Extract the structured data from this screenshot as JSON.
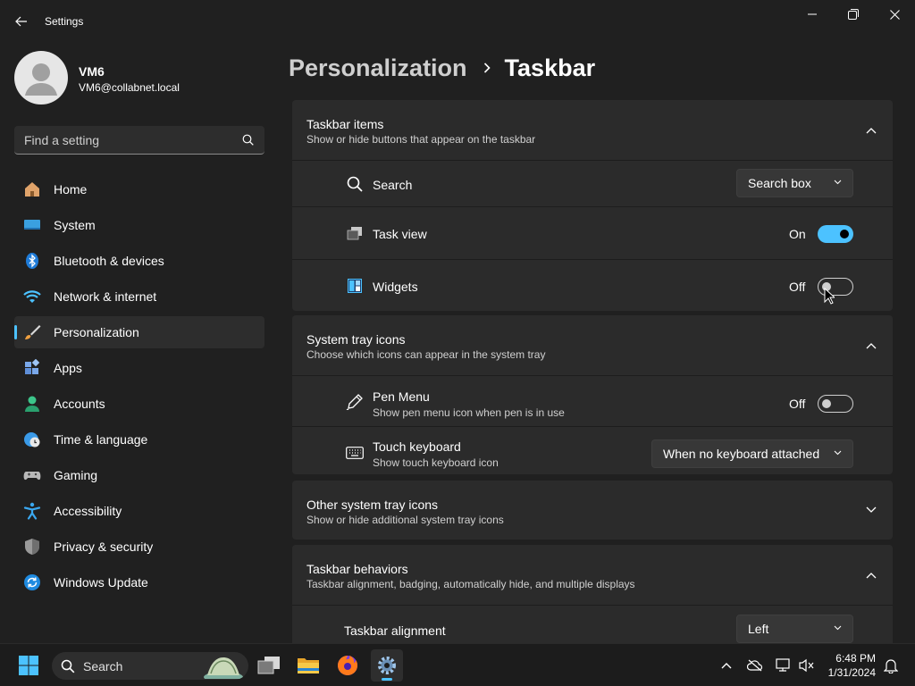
{
  "window": {
    "title": "Settings"
  },
  "user": {
    "name": "VM6",
    "email": "VM6@collabnet.local"
  },
  "search": {
    "placeholder": "Find a setting"
  },
  "nav": {
    "items": [
      {
        "label": "Home",
        "icon": "home-icon"
      },
      {
        "label": "System",
        "icon": "system-icon"
      },
      {
        "label": "Bluetooth & devices",
        "icon": "bluetooth-icon"
      },
      {
        "label": "Network & internet",
        "icon": "wifi-icon"
      },
      {
        "label": "Personalization",
        "icon": "brush-icon",
        "active": true
      },
      {
        "label": "Apps",
        "icon": "apps-icon"
      },
      {
        "label": "Accounts",
        "icon": "accounts-icon"
      },
      {
        "label": "Time & language",
        "icon": "clock-globe-icon"
      },
      {
        "label": "Gaming",
        "icon": "gamepad-icon"
      },
      {
        "label": "Accessibility",
        "icon": "accessibility-icon"
      },
      {
        "label": "Privacy & security",
        "icon": "shield-icon"
      },
      {
        "label": "Windows Update",
        "icon": "update-icon"
      }
    ]
  },
  "breadcrumb": {
    "parent": "Personalization",
    "current": "Taskbar"
  },
  "taskbar_items": {
    "title": "Taskbar items",
    "subtitle": "Show or hide buttons that appear on the taskbar",
    "search": {
      "label": "Search",
      "value": "Search box"
    },
    "task_view": {
      "label": "Task view",
      "state": "On",
      "on": true
    },
    "widgets": {
      "label": "Widgets",
      "state": "Off",
      "on": false
    }
  },
  "system_tray": {
    "title": "System tray icons",
    "subtitle": "Choose which icons can appear in the system tray",
    "pen_menu": {
      "label": "Pen Menu",
      "sub": "Show pen menu icon when pen is in use",
      "state": "Off",
      "on": false
    },
    "touch_keyboard": {
      "label": "Touch keyboard",
      "sub": "Show touch keyboard icon",
      "value": "When no keyboard attached"
    }
  },
  "other_tray": {
    "title": "Other system tray icons",
    "subtitle": "Show or hide additional system tray icons"
  },
  "behaviors": {
    "title": "Taskbar behaviors",
    "subtitle": "Taskbar alignment, badging, automatically hide, and multiple displays",
    "alignment": {
      "label": "Taskbar alignment",
      "value": "Left"
    }
  },
  "taskbar": {
    "search_label": "Search",
    "time": "6:48 PM",
    "date": "1/31/2024"
  },
  "colors": {
    "accent": "#4cc2ff",
    "background": "#202020",
    "card": "#2b2b2b"
  }
}
